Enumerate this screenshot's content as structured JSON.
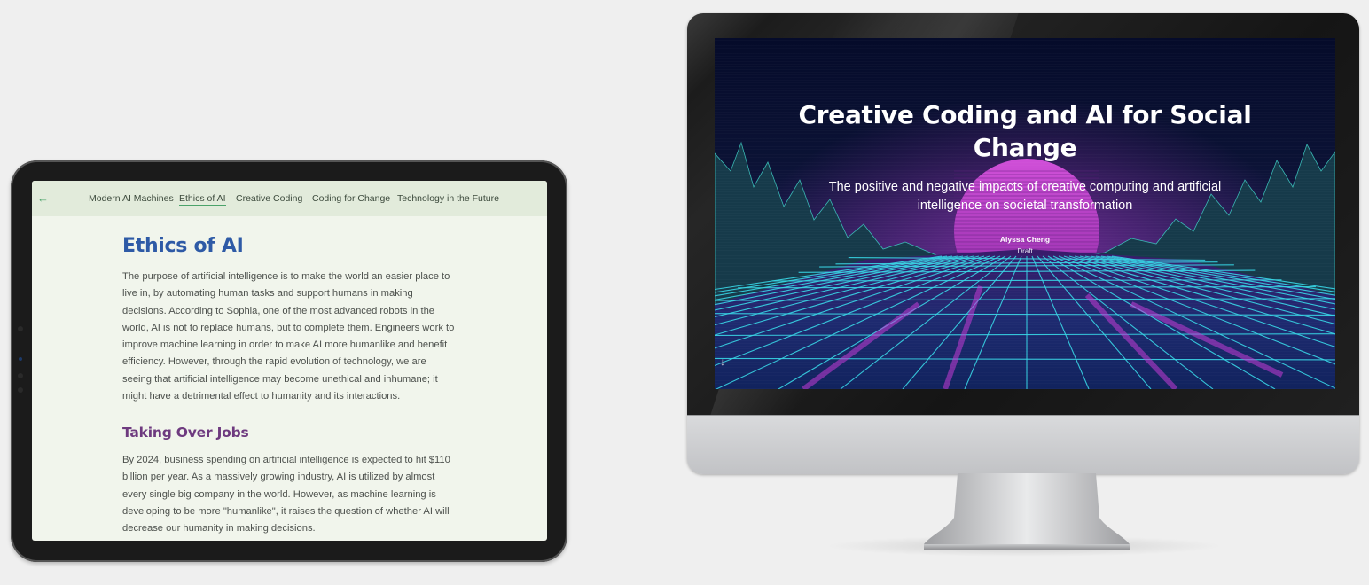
{
  "tablet": {
    "nav": {
      "back_icon": "arrow-left-icon",
      "items": [
        {
          "label": "Modern AI Machines",
          "active": false
        },
        {
          "label": "Ethics of AI",
          "active": true
        },
        {
          "label": "Creative Coding",
          "active": false
        },
        {
          "label": "Coding for Change",
          "active": false
        },
        {
          "label": "Technology in the Future",
          "active": false
        }
      ]
    },
    "article": {
      "title": "Ethics of AI",
      "intro": "The purpose of artificial intelligence is to make the world an easier place to live in, by automating human tasks and support humans in making decisions. According to Sophia, one of the most advanced robots in the world, AI is not to replace humans, but to complete them. Engineers work to improve machine learning in order to make AI more humanlike and benefit efficiency. However, through the rapid evolution of technology, we are seeing that artificial intelligence may become unethical and inhumane; it might have a detrimental effect to humanity and its interactions.",
      "section_title": "Taking Over Jobs",
      "section_text": "By 2024, business spending on artificial intelligence is expected to hit $110 billion per year. As a massively growing industry, AI is utilized by almost every single big company in the world. However, as machine learning is developing to be more \"humanlike\", it raises the question of whether AI will decrease our humanity in making decisions."
    }
  },
  "monitor": {
    "slide": {
      "title": "Creative Coding and AI for Social Change",
      "subtitle": "The positive and negative impacts of creative computing and artificial intelligence on societal transformation",
      "author": "Alyssa Cheng",
      "status": "Draft",
      "scroll_icon": "arrow-down-icon"
    }
  },
  "colors": {
    "accent_green": "#4ba36a",
    "title_blue": "#2e5aa6",
    "subtitle_purple": "#6e3a7f",
    "neon_cyan": "#37d6e6",
    "neon_magenta": "#c43ad6"
  }
}
